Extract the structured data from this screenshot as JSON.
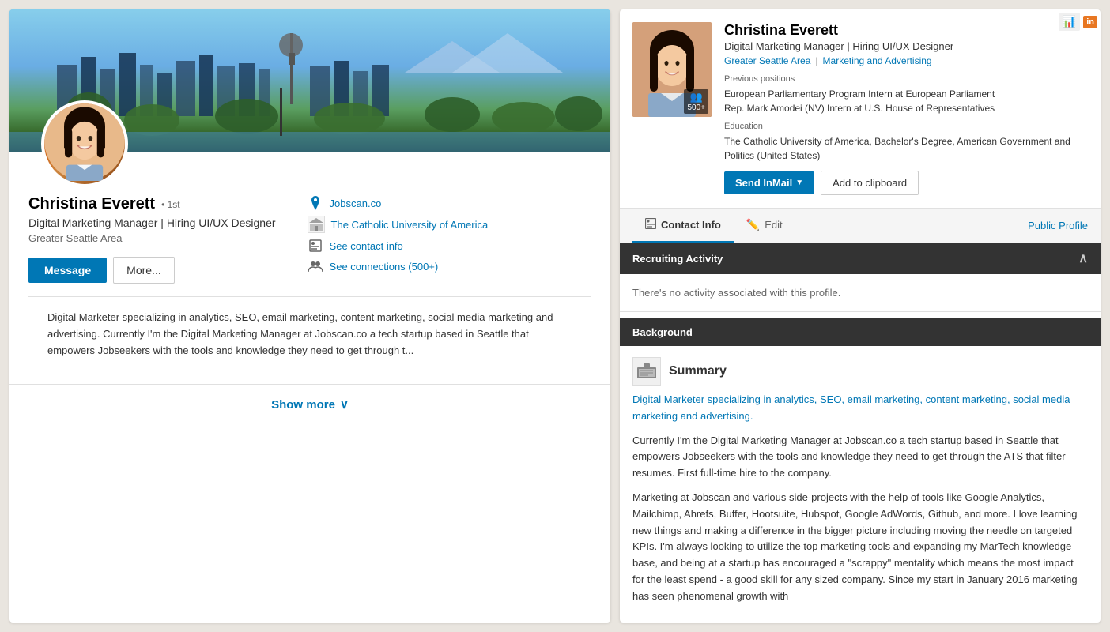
{
  "left": {
    "person": {
      "name": "Christina Everett",
      "badge": "• 1st",
      "title": "Digital Marketing Manager | Hiring UI/UX Designer",
      "location": "Greater Seattle Area"
    },
    "buttons": {
      "message": "Message",
      "more": "More..."
    },
    "links": [
      {
        "icon": "drop-icon",
        "text": "Jobscan.co"
      },
      {
        "icon": "school-icon",
        "text": "The Catholic University of America"
      },
      {
        "icon": "contact-icon",
        "text": "See contact info"
      },
      {
        "icon": "connections-icon",
        "text": "See connections (500+)"
      }
    ],
    "summary": "Digital Marketer specializing in analytics, SEO, email marketing, content marketing, social media marketing and advertising. Currently I'm the Digital Marketing Manager at Jobscan.co a tech startup based in Seattle that empowers Jobseekers with the tools and knowledge they need to get through t...",
    "show_more": "Show more"
  },
  "right": {
    "person": {
      "name": "Christina Everett",
      "title": "Digital Marketing Manager | Hiring UI/UX Designer",
      "location": "Greater Seattle Area",
      "industry": "Marketing and Advertising"
    },
    "previous_positions_label": "Previous positions",
    "previous_positions": "European Parliamentary Program Intern at European Parliament\nRep. Mark Amodei (NV) Intern at U.S. House of Representatives",
    "education_label": "Education",
    "education": "The Catholic University of America, Bachelor's Degree, American Government and Politics (United States)",
    "connections": "500+",
    "buttons": {
      "send_inmail": "Send InMail",
      "add_to_clipboard": "Add to clipboard"
    },
    "tabs": [
      {
        "label": "Contact Info",
        "icon": "contact-icon",
        "active": true
      },
      {
        "label": "Edit",
        "icon": "edit-icon",
        "active": false
      }
    ],
    "public_profile": "Public Profile",
    "recruiting_activity": {
      "title": "Recruiting Activity",
      "no_activity": "There's no activity associated with this profile."
    },
    "background": {
      "title": "Background",
      "summary_title": "Summary",
      "summary_p1_highlight": "Digital Marketer specializing in analytics, SEO, email marketing, content marketing, social media marketing and advertising.",
      "summary_p2": "Currently I'm the Digital Marketing Manager at Jobscan.co a tech startup based in Seattle that empowers Jobseekers with the tools and knowledge they need to get through the ATS that filter resumes. First full-time hire to the company.",
      "summary_p3": "Marketing at Jobscan and various side-projects with the help of tools like Google Analytics, Mailchimp, Ahrefs, Buffer, Hootsuite, Hubspot, Google AdWords, Github, and more. I love learning new things and making a difference in the bigger picture including moving the needle on targeted KPIs. I'm always looking to utilize the top marketing tools and expanding my MarTech knowledge base, and being at a startup has encouraged a \"scrappy\" mentality which means the most impact for the least spend - a good skill for any sized company. Since my start in January 2016 marketing has seen phenomenal growth with"
    }
  }
}
